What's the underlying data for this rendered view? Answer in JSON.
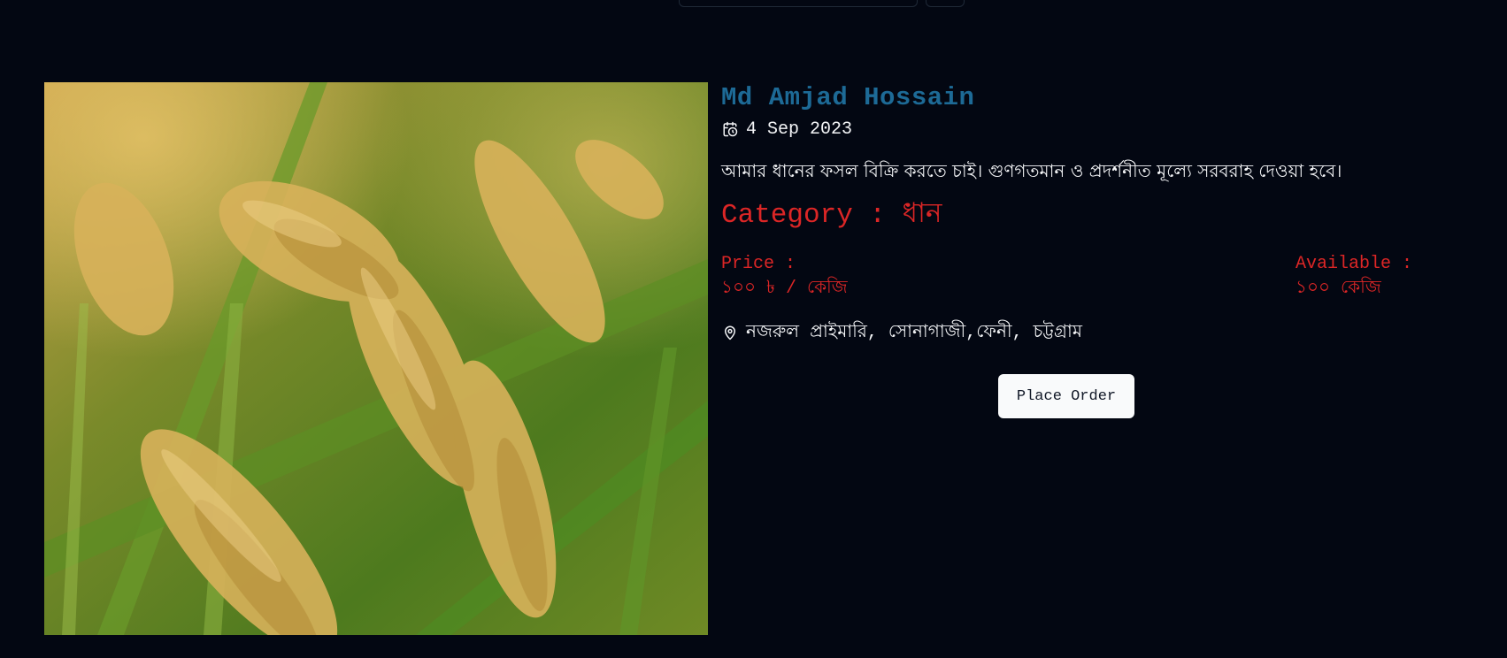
{
  "seller": {
    "name": "Md Amjad Hossain",
    "date": "4 Sep 2023"
  },
  "listing": {
    "description": "আমার ধানের ফসল বিক্রি করতে চাই। গুণগতমান ও প্রদর্শনীত মূল্যে সরবরাহ দেওয়া হবে।",
    "category_text": "Category : ধান",
    "price_label": "Price :",
    "price_value": "১০০ ৳ / কেজি",
    "available_label": "Available :",
    "available_value": "১০০ কেজি",
    "location": "নজরুল প্রাইমারি, সোনাগাজী,ফেনী, চট্টগ্রাম"
  },
  "actions": {
    "place_order_label": "Place Order"
  },
  "icons": {
    "date": "calendar-clock-icon",
    "location": "map-pin-icon"
  },
  "colors": {
    "background": "#030712",
    "seller_name": "#1d6a96",
    "accent_red": "#dc2626",
    "button_bg": "#f9fafb"
  }
}
